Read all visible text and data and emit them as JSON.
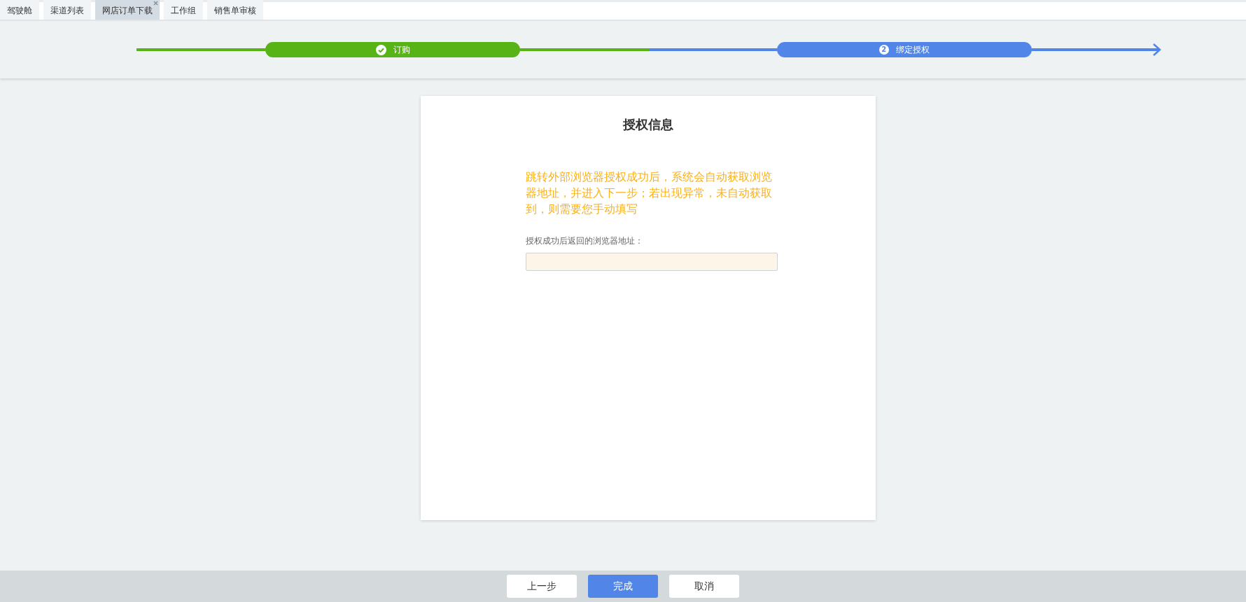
{
  "tabs": [
    {
      "label": "驾驶舱",
      "selected": false
    },
    {
      "label": "渠道列表",
      "selected": false
    },
    {
      "label": "网店订单下载",
      "selected": true
    },
    {
      "label": "工作组",
      "selected": false
    },
    {
      "label": "销售单审核",
      "selected": false
    }
  ],
  "steps": [
    {
      "label": "订购",
      "done": true
    },
    {
      "label": "绑定授权",
      "number": "2",
      "done": false
    }
  ],
  "card": {
    "title": "授权信息",
    "notice": "跳转外部浏览器授权成功后，系统会自动获取浏览器地址，并进入下一步；若出现异常，未自动获取到，则需要您手动填写",
    "field_label": "授权成功后返回的浏览器地址："
  },
  "buttons": [
    {
      "label": "上一步",
      "primary": false
    },
    {
      "label": "完成",
      "primary": true
    },
    {
      "label": "取消",
      "primary": false
    }
  ]
}
